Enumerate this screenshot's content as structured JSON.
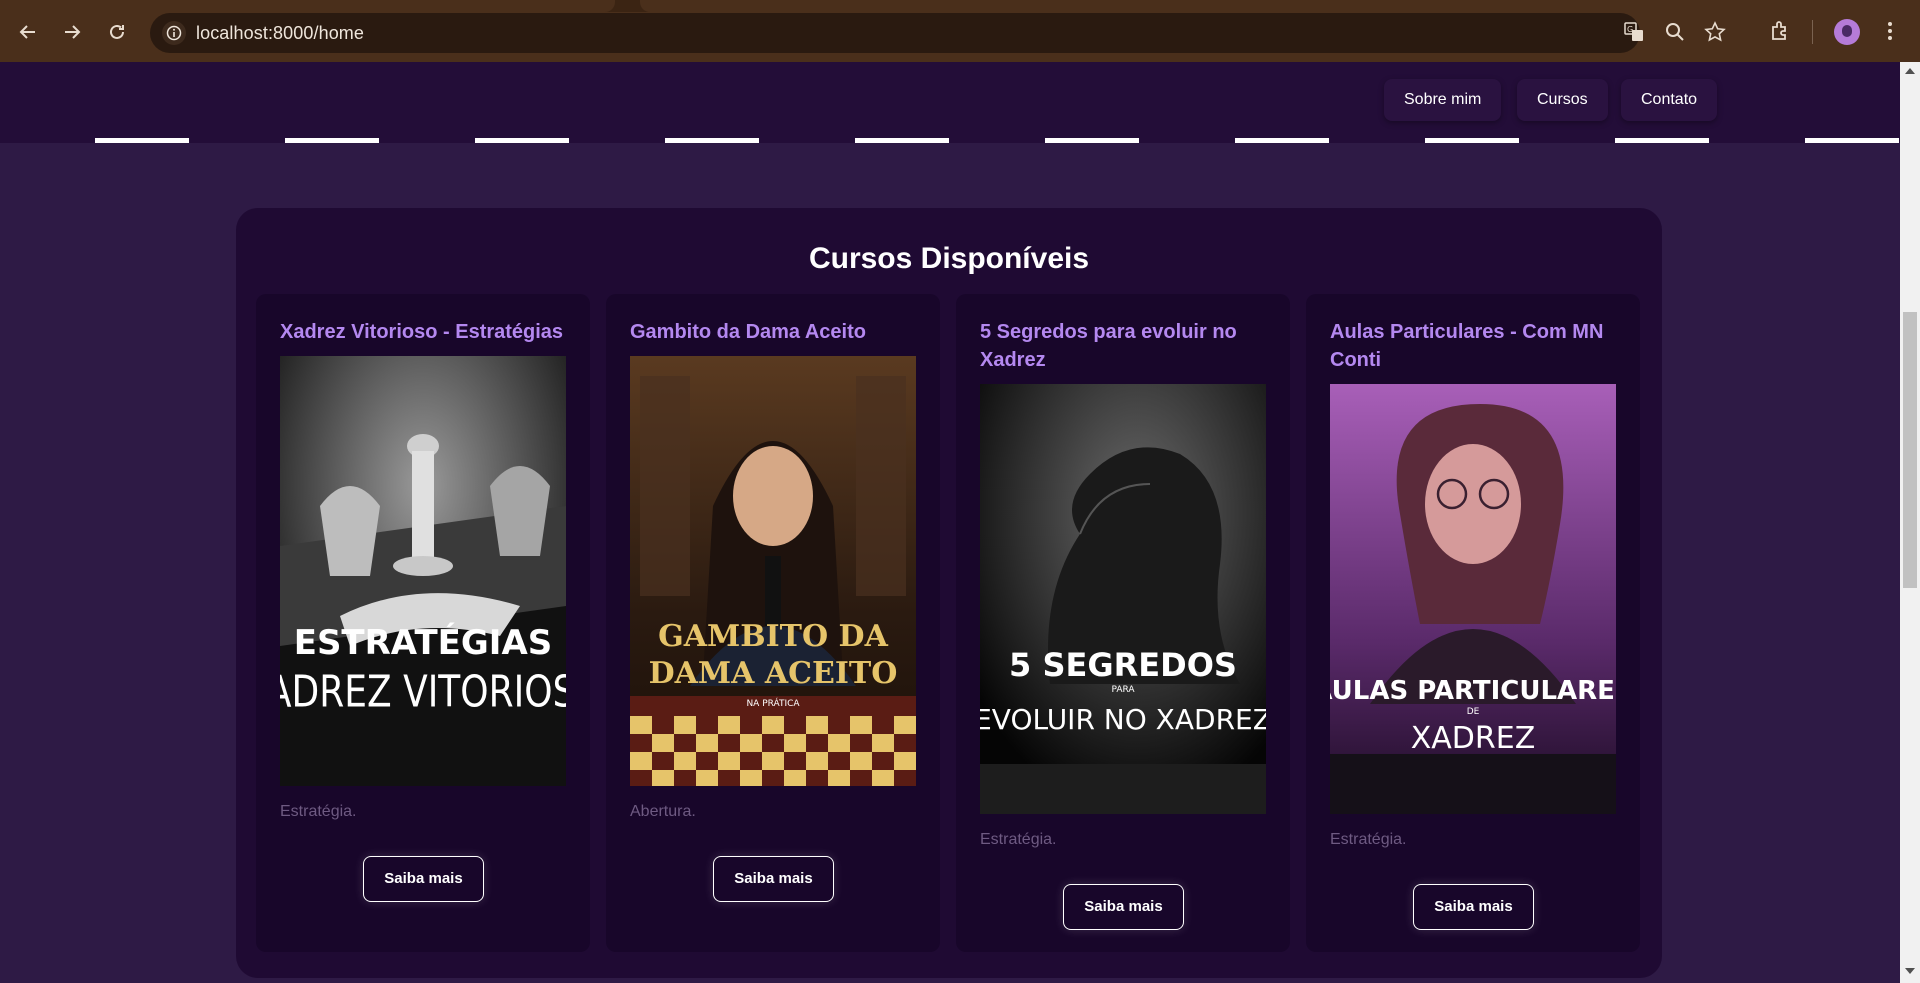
{
  "browser": {
    "url": "localhost:8000/home",
    "icons": [
      "back-icon",
      "forward-icon",
      "reload-icon",
      "site-info-icon",
      "translate-icon",
      "zoom-icon",
      "bookmark-star-icon",
      "extensions-icon",
      "profile-avatar",
      "menu-icon"
    ]
  },
  "header": {
    "nav": [
      {
        "label": "Sobre mim"
      },
      {
        "label": "Cursos"
      },
      {
        "label": "Contato"
      }
    ]
  },
  "courses": {
    "title": "Cursos Disponíveis",
    "items": [
      {
        "title": "Xadrez Vitorioso - Estratégias",
        "cover": {
          "line1": "ESTRATÉGIAS",
          "line2": "XADREZ VITORIOSO"
        },
        "category": "Estratégia.",
        "button": "Saiba mais"
      },
      {
        "title": "Gambito da Dama Aceito",
        "cover": {
          "line1": "GAMBITO DA",
          "line2": "DAMA ACEITO",
          "line3": "NA PRÁTICA"
        },
        "category": "Abertura.",
        "button": "Saiba mais"
      },
      {
        "title": "5 Segredos para evoluir no Xadrez",
        "cover": {
          "line1": "5 SEGREDOS",
          "line2": "PARA",
          "line3": "EVOLUIR NO XADREZ"
        },
        "category": "Estratégia.",
        "button": "Saiba mais"
      },
      {
        "title": "Aulas Particulares - Com MN Conti",
        "cover": {
          "line1": "AULAS PARTICULARES",
          "line2": "DE",
          "line3": "XADREZ"
        },
        "category": "Estratégia.",
        "button": "Saiba mais"
      }
    ]
  },
  "colors": {
    "page_bg": "#2e1a45",
    "header_bg": "#230d38",
    "panel_bg": "#1f0a33",
    "card_bg": "#18062a",
    "card_title": "#b488f0",
    "category_text": "#6e5a82",
    "browser_chrome": "#4a2f1b"
  }
}
